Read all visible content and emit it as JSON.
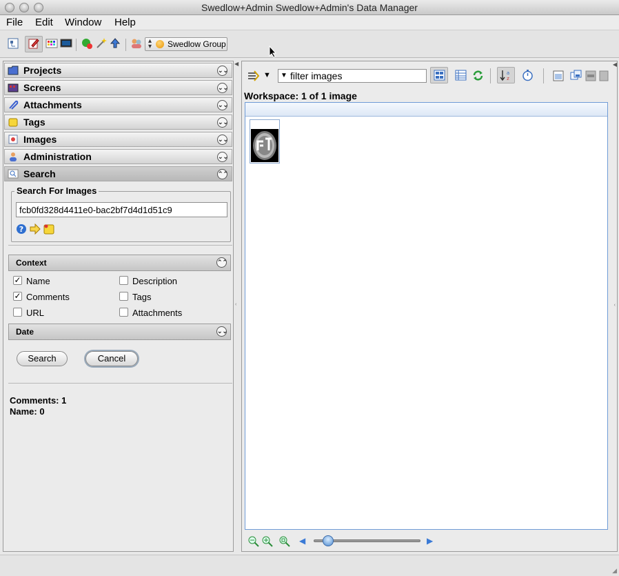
{
  "window": {
    "title": "Swedlow+Admin Swedlow+Admin's Data Manager"
  },
  "menu": {
    "file": "File",
    "edit": "Edit",
    "window": "Window",
    "help": "Help"
  },
  "toolbar": {
    "group_label": "Swedlow Group"
  },
  "sidebar": {
    "sections": [
      {
        "label": "Projects"
      },
      {
        "label": "Screens"
      },
      {
        "label": "Attachments"
      },
      {
        "label": "Tags"
      },
      {
        "label": "Images"
      },
      {
        "label": "Administration"
      },
      {
        "label": "Search"
      }
    ]
  },
  "search": {
    "legend": "Search For Images",
    "query": "fcb0fd328d4411e0-bac2bf7d4d1d51c9",
    "context_label": "Context",
    "date_label": "Date",
    "options": {
      "name": "Name",
      "description": "Description",
      "comments": "Comments",
      "tags": "Tags",
      "url": "URL",
      "attachments": "Attachments"
    },
    "checked": {
      "name": true,
      "description": false,
      "comments": true,
      "tags": false,
      "url": false,
      "attachments": false
    },
    "search_button": "Search",
    "cancel_button": "Cancel",
    "results": {
      "comments": "Comments: 1",
      "name": "Name: 0"
    }
  },
  "browser": {
    "filter_text": "filter  images",
    "workspace_label": "Workspace: 1 of 1 image",
    "zoom_level": 0.1
  },
  "colors": {
    "accent": "#6f9bd6",
    "panel_bg": "#ebebeb"
  }
}
